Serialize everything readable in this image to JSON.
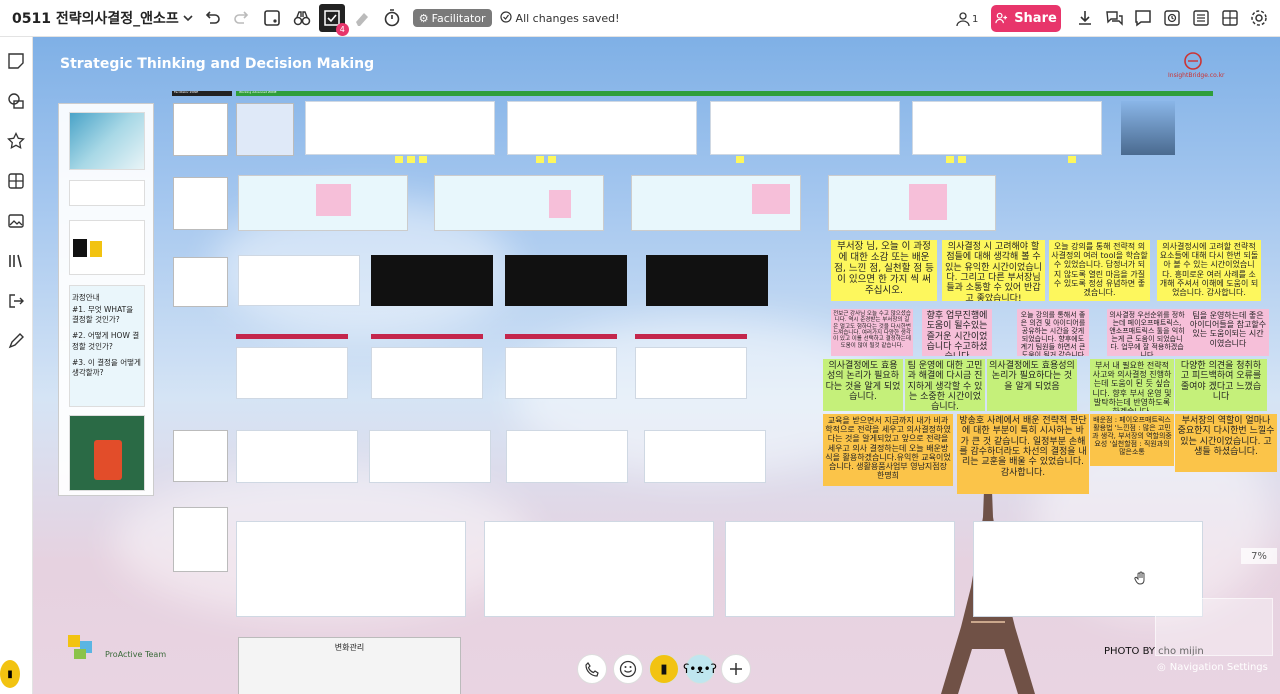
{
  "topbar": {
    "board_title": "0511 전략의사결정_앤소프",
    "facilitator_label": "Facilitator",
    "saved_status": "All changes saved!",
    "user_count": "1",
    "share_label": "Share",
    "badge_count": "4"
  },
  "canvas": {
    "header_title": "Strategic Thinking and Decision Making",
    "logo_text": "InsightBridge.co.kr",
    "zone_label_1": "Facilitator ZONE",
    "zone_label_2": "Working Advanced ZONE",
    "agenda_title": "과정안내",
    "agenda_items": [
      "#1. 무엇 WHAT을 결정할 것인가?",
      "#2. 어떻게 HOW 결정할 것인가?",
      "#3. 이 결정을 어떻게 생각할까?"
    ],
    "brand_text": "ProActive Team",
    "photo_credit": "PHOTO BY cho mijin",
    "zoom_level": "7%",
    "nav_settings": "Navigation Settings",
    "bottom_box_title": "변화관리"
  },
  "stickies": [
    {
      "text": "부서장 님, 오늘 이 과정에 대한 소감 또는 배운 점, 느낀 점, 실천할 점 등이 있으면 한 가지 씩 써 주십시오.",
      "color": "#fdf75d"
    },
    {
      "text": "의사결정 시 고려해야 할 점들에 대해 생각해 볼 수 있는 유익한 시간이었습니다. 그리고 다른 부서장님들과 소통할 수 있어 반갑고 좋았습니다!",
      "color": "#fdf75d"
    },
    {
      "text": "오늘 강의를 통해 전략적 의사결정의 여러 tool을 학습할 수 있었습니다. 답정너가 되지 않도록 열린 마음을 가질 수 있도록 정성 유념하면 좋겠습니다.",
      "color": "#fdf75d"
    },
    {
      "text": "의사결정시에 고려할 전략적 요소들에 대해 다시 한번 되돌아 볼 수 있는 시간이었습니다. 흥미로운 여러 사례를 소개해 주셔서 이해에 도움이 되었습니다. 감사합니다.",
      "color": "#fdf75d"
    },
    {
      "text": "전보근 강사님 오늘 수고 많으셨습니다. 역시 준경받는 부서장의 길은 멀고도 험하다는 것을 다시한번 느껴습니다. 여러가지 다양한 생각이 있고 이를 선택하고 결정하는데 도움이 많이 될것 같습니다.",
      "color": "#f6bfd9"
    },
    {
      "text": "향후 업무진행에 도움이 될수있는 즐거운 시간이었습니다 수고하셨습니다",
      "color": "#f6bfd9"
    },
    {
      "text": "오늘 강의를 통해서 좋은 의견 및 아이디어를 공유하는 시간을 갖게 되었습니다. 향후에도 계기 팀원들 하면서 큰 도움이 될거 같습니다",
      "color": "#f6bfd9"
    },
    {
      "text": "의사결정 우선순위를 정하는데 페이오프매트릭스, 앤소프매트릭스 툴을 익히는게 큰 도움이 되었습니다. 업무에 잘 적용하겠습니다",
      "color": "#f6bfd9"
    },
    {
      "text": "팀을 운영하는데 좋은 아이디어들을 참고할수 있는 도움이되는 시간이였습니다",
      "color": "#f6bfd9"
    },
    {
      "text": "의사결정에도 효용성의 논리가 필요하다는 것을 알게 되었습니다.",
      "color": "#c5f07a"
    },
    {
      "text": "팀 운영에 대한 고민과 해결에 다시금 진지하게 생각할 수 있는 소중한 시간이었습니다.",
      "color": "#c5f07a"
    },
    {
      "text": "의사결정에도 효용성의 논리가 필요하다는 것을 알게 되었음",
      "color": "#c5f07a"
    },
    {
      "text": "부서 내 필요한 전략적 사고와 의사결정 진행하는데 도움이 된 듯 싶습니다. 향후 부서 운영 및 발탁하는데 반영하도록 하겠습니다.",
      "color": "#c5f07a"
    },
    {
      "text": "다양한 의견을 청취하고 피드백하여 오류를 줄여야 겠다고 느꼈습니다",
      "color": "#c5f07a"
    },
    {
      "text": "교육을 받으면서 지금까지 내가 비과학적으로 전략을 세우고 의사결정하였다는 것을 알게되었고 앞으로 전략을 세우고 의사 결정하는데 오늘 배운방식을 활용하겠습니다.유익한 교육이었습니다. 생활용품사업부 영남지점장 한명희",
      "color": "#fbc449"
    },
    {
      "text": "방송호 사례에서 배운 전략적 판단에 대한 부분이 특히 시사하는 바가 큰 것 같습니다. 일정부분 손해를 감수하더라도 차선의 결정을 내리는 교훈을 배울 수 있었습니다. 감사합니다.",
      "color": "#fbc449"
    },
    {
      "text": "배운점 : 페이오프매트릭스 활용법 '느낀점 : 많은 고민과 생각, 부서장의 역할의중요성 '실천할점 : 직원과의 많은소통",
      "color": "#fbc449"
    },
    {
      "text": "부서장의 역할이 얼마나 중요한지 다시한번 느낄수 있는 시간이었습니다. 고생들 하셨습니다.",
      "color": "#fbc449"
    }
  ],
  "colors": {
    "accent": "#e8356b",
    "zone_green": "#2f9e3a",
    "zone_dark": "#222222"
  }
}
